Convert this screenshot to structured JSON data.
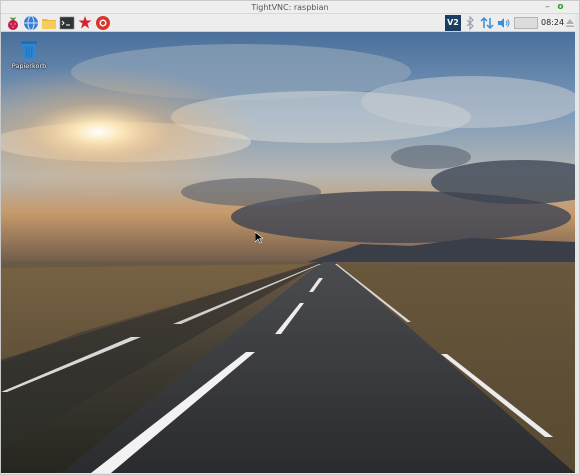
{
  "window": {
    "title": "TightVNC: raspbian",
    "minimize_label": "–",
    "maximize_label": "o"
  },
  "panel": {
    "launchers": [
      {
        "icon": "raspberry-menu-icon"
      },
      {
        "icon": "web-browser-icon"
      },
      {
        "icon": "file-manager-icon"
      },
      {
        "icon": "terminal-icon"
      },
      {
        "icon": "mathematica-icon"
      },
      {
        "icon": "wolfram-icon"
      }
    ],
    "tray": {
      "vnc_label": "V2",
      "clock": "08:24"
    }
  },
  "desktop": {
    "icons": [
      {
        "label": "Papierkorb",
        "icon": "trash-icon"
      }
    ]
  },
  "colors": {
    "panel_bg": "#ededed",
    "raspberry_red": "#c51a4a",
    "vnc_badge": "#1b3f63",
    "trash_blue": "#2f86d0"
  }
}
